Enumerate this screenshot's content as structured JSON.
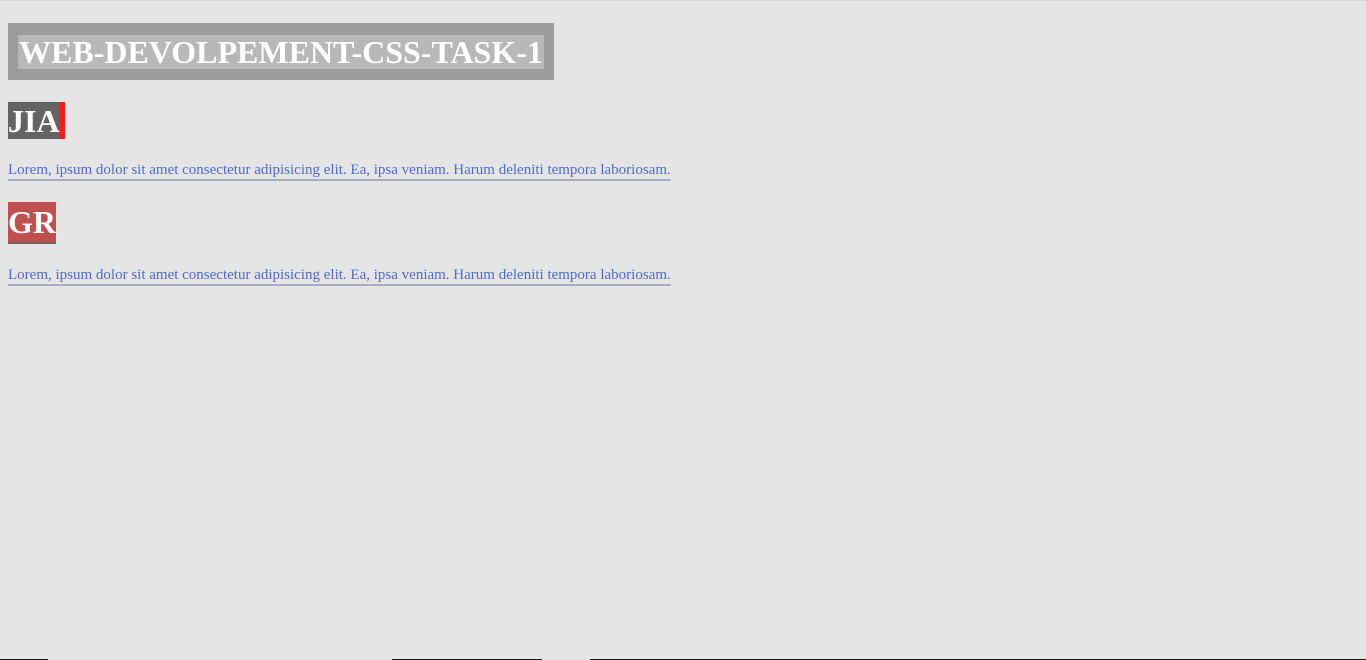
{
  "header": {
    "title": "WEB-DEVOLPEMENT-CSS-TASK-1"
  },
  "sections": [
    {
      "heading": "JIA",
      "text": "Lorem, ipsum dolor sit amet consectetur adipisicing elit. Ea, ipsa veniam. Harum deleniti tempora laboriosam."
    },
    {
      "heading": "GR",
      "text": "Lorem, ipsum dolor sit amet consectetur adipisicing elit. Ea, ipsa veniam. Harum deleniti tempora laboriosam."
    }
  ],
  "colors": {
    "page_background": "#e5e5e5",
    "title_box": "#9d9c9c",
    "jia_background": "#636363",
    "jia_accent": "#ff1a1a",
    "gr_background": "#c0504e",
    "link_text": "#4f6bcf"
  }
}
